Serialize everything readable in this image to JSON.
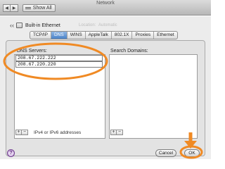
{
  "window": {
    "title": "Network",
    "back_glyph": "◀",
    "forward_glyph": "▶",
    "show_all_label": "Show All"
  },
  "location": {
    "label_bg": "Location:",
    "value_bg": "Automatic"
  },
  "interface": {
    "name": "Built-in Ethernet",
    "back_glyph": "‹‹"
  },
  "tabs": [
    {
      "label": "TCP/IP",
      "selected": false
    },
    {
      "label": "DNS",
      "selected": true
    },
    {
      "label": "WINS",
      "selected": false
    },
    {
      "label": "AppleTalk",
      "selected": false
    },
    {
      "label": "802.1X",
      "selected": false
    },
    {
      "label": "Proxies",
      "selected": false
    },
    {
      "label": "Ethernet",
      "selected": false
    }
  ],
  "dns": {
    "label": "DNS Servers:",
    "servers": [
      "208.67.222.222",
      "208.67.220.220"
    ]
  },
  "search": {
    "label": "Search Domains:"
  },
  "controls": {
    "plus": "+",
    "minus": "−",
    "ip_note": "IPv4 or IPv6 addresses"
  },
  "footer": {
    "help": "?",
    "cancel": "Cancel",
    "ok": "OK"
  },
  "colors": {
    "highlight_orange": "#f08a24",
    "tab_selected": "#4a82c8"
  }
}
